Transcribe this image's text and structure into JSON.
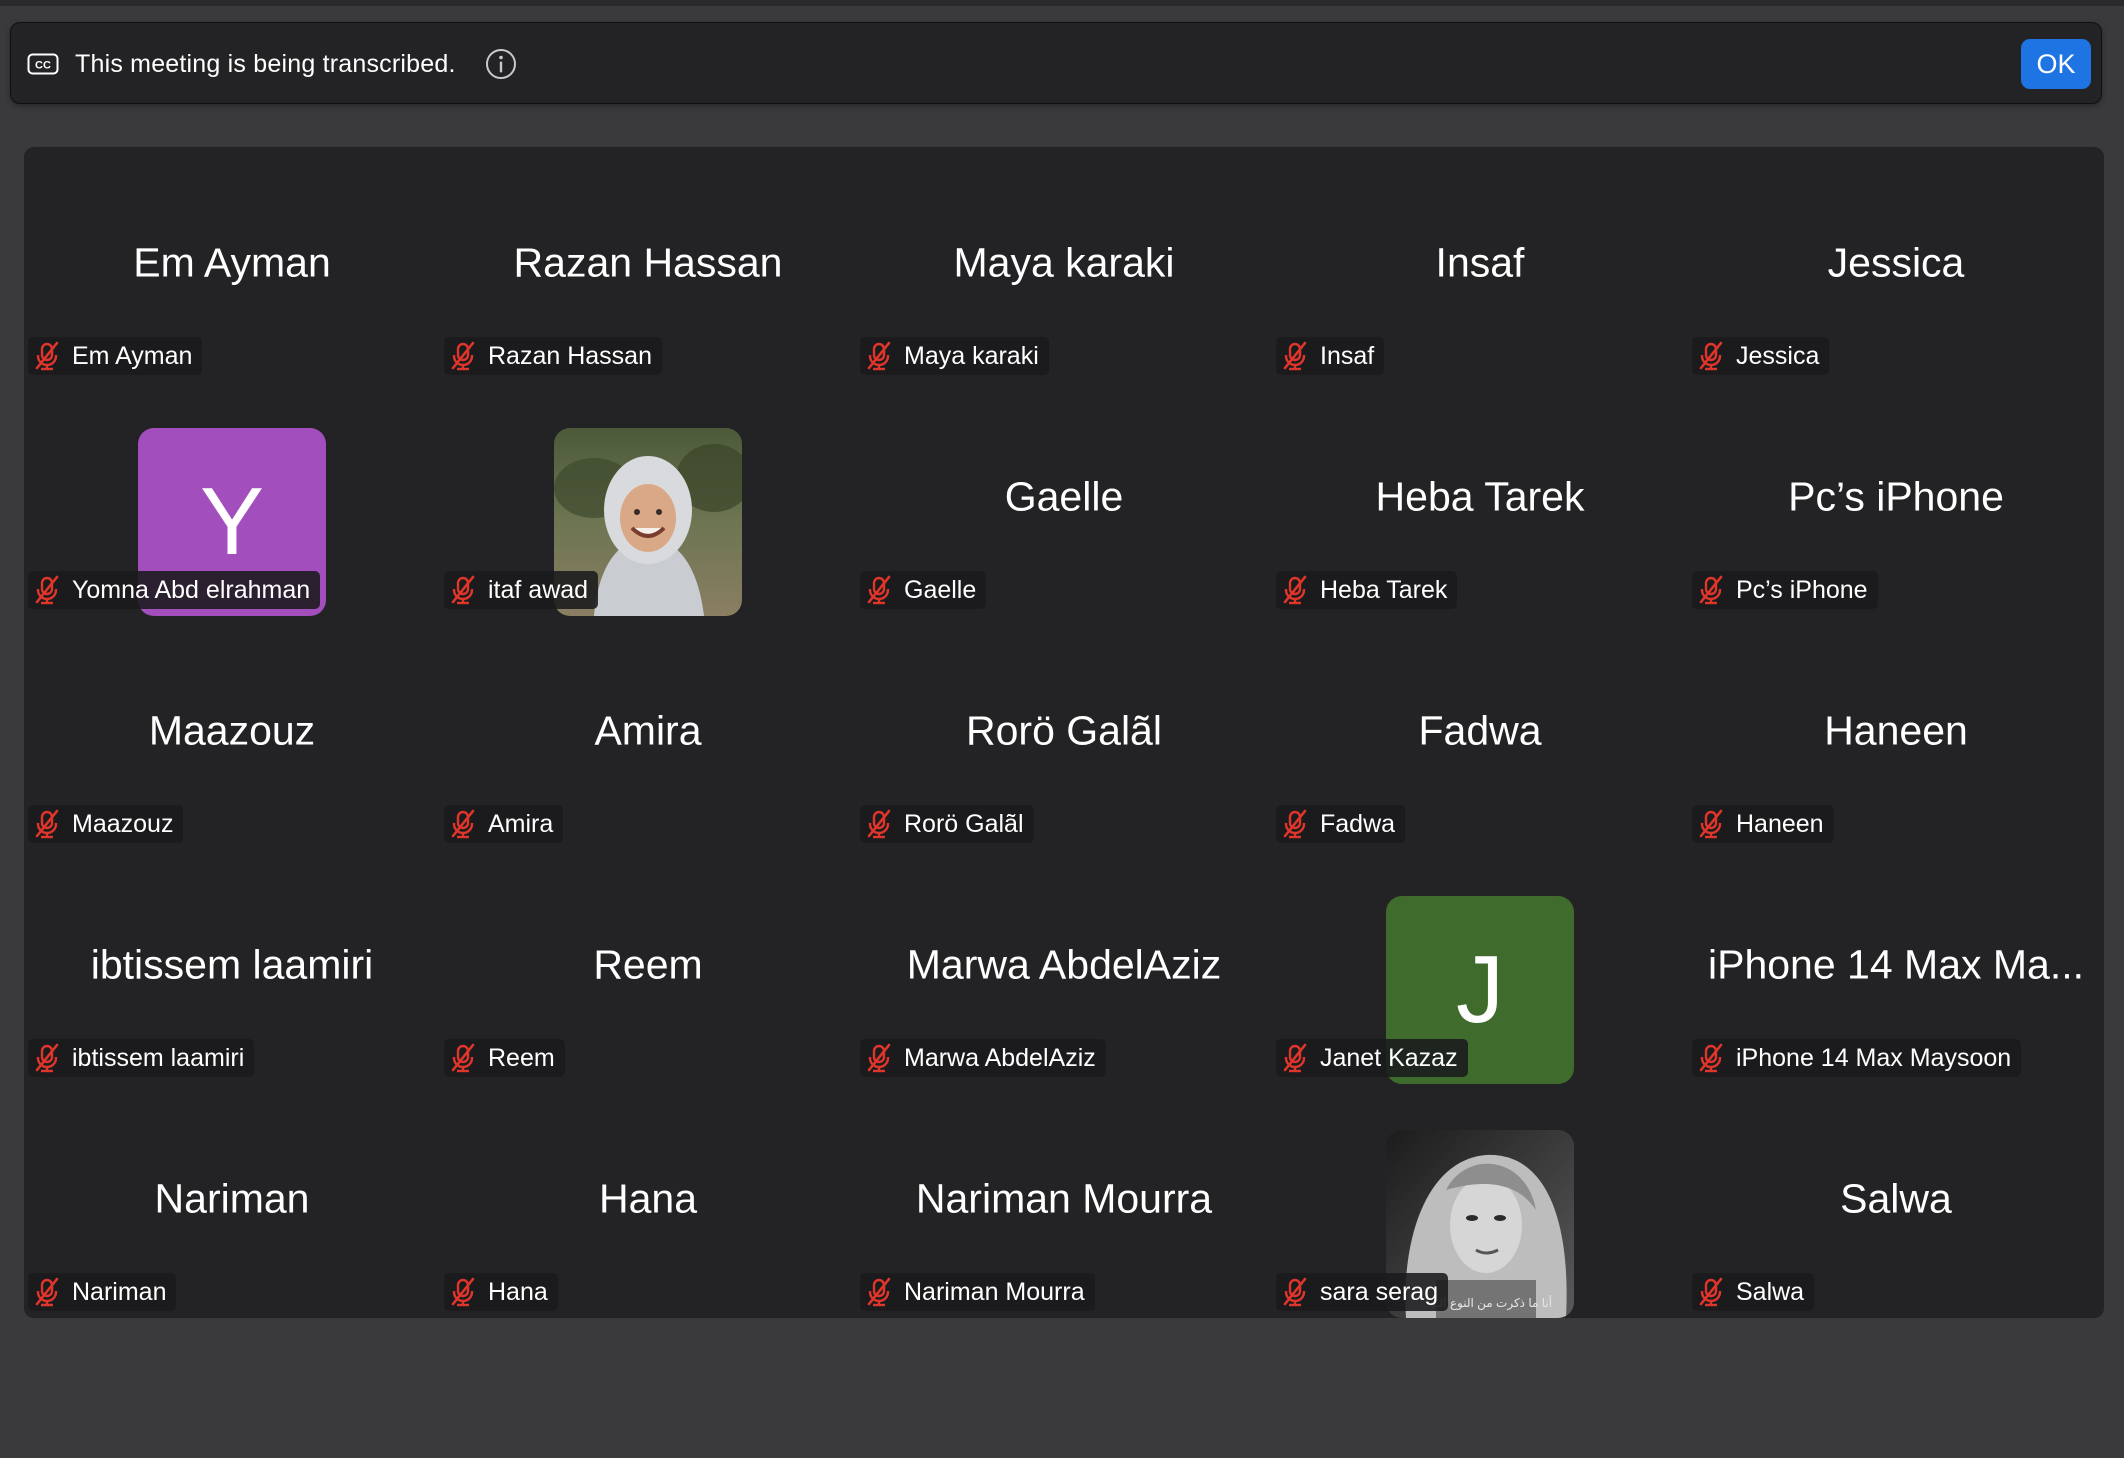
{
  "banner": {
    "text": "This meeting is being transcribed.",
    "ok_label": "OK",
    "cc_icon_label": "CC"
  },
  "colors": {
    "accent": "#1f74e3",
    "muted_mic": "#e0352b",
    "tile_bg": "#232325"
  },
  "participants": [
    {
      "display": "Em Ayman",
      "label": "Em Ayman",
      "muted": true
    },
    {
      "display": "Razan Hassan",
      "label": "Razan Hassan",
      "muted": true
    },
    {
      "display": "Maya karaki",
      "label": "Maya karaki",
      "muted": true
    },
    {
      "display": "Insaf",
      "label": "Insaf",
      "muted": true
    },
    {
      "display": "Jessica",
      "label": "Jessica",
      "muted": true
    },
    {
      "display": "",
      "label": "Yomna Abd elrahman",
      "muted": true,
      "avatar_letter": "Y",
      "avatar_color": "#a24fbd"
    },
    {
      "display": "",
      "label": "itaf awad",
      "muted": true,
      "avatar_photo": "woman-in-light-headscarf-smiling-outdoors"
    },
    {
      "display": "Gaelle",
      "label": "Gaelle",
      "muted": true
    },
    {
      "display": "Heba Tarek",
      "label": "Heba Tarek",
      "muted": true
    },
    {
      "display": "Pc’s iPhone",
      "label": "Pc’s iPhone",
      "muted": true
    },
    {
      "display": "Maazouz",
      "label": "Maazouz",
      "muted": true
    },
    {
      "display": "Amira",
      "label": "Amira",
      "muted": true
    },
    {
      "display": "Rorö Galãl",
      "label": "Rorö Galãl",
      "muted": true
    },
    {
      "display": "Fadwa",
      "label": "Fadwa",
      "muted": true
    },
    {
      "display": "Haneen",
      "label": "Haneen",
      "muted": true
    },
    {
      "display": "ibtissem laamiri",
      "label": "ibtissem laamiri",
      "muted": true
    },
    {
      "display": "Reem",
      "label": "Reem",
      "muted": true
    },
    {
      "display": "Marwa AbdelAziz",
      "label": "Marwa AbdelAziz",
      "muted": true
    },
    {
      "display": "",
      "label": "Janet Kazaz",
      "muted": true,
      "avatar_letter": "J",
      "avatar_color": "#3f6b2c"
    },
    {
      "display": "iPhone 14 Max Ma...",
      "label": "iPhone 14 Max Maysoon",
      "muted": true
    },
    {
      "display": "Nariman",
      "label": "Nariman",
      "muted": true
    },
    {
      "display": "Hana",
      "label": "Hana",
      "muted": true
    },
    {
      "display": "Nariman Mourra",
      "label": "Nariman Mourra",
      "muted": true
    },
    {
      "display": "",
      "label": "sara serag",
      "muted": true,
      "avatar_photo": "black-and-white-portrait-of-woman",
      "avatar_caption": "أنا ما ذكرت من النوع الـ"
    },
    {
      "display": "Salwa",
      "label": "Salwa",
      "muted": true
    }
  ]
}
